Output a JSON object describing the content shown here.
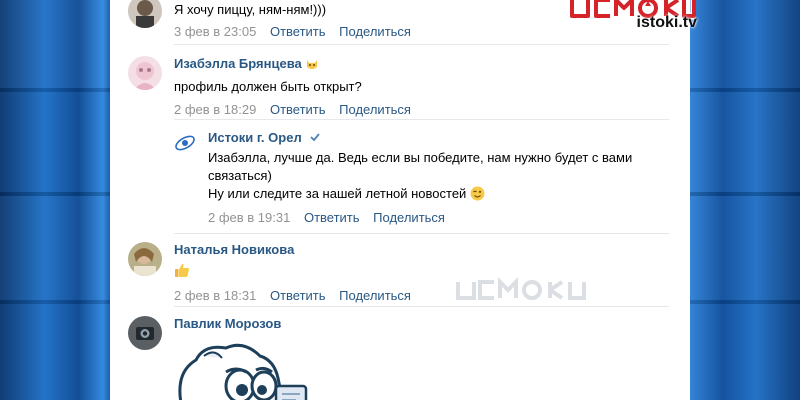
{
  "comments": [
    {
      "author": "",
      "text": "Я хочу пиццу, ням-ням!)))",
      "date": "3 фев в 23:05",
      "reply": "Ответить",
      "share": "Поделиться"
    },
    {
      "author": "Изабэлла Брянцева",
      "text": "профиль должен быть открыт?",
      "date": "2 фев в 18:29",
      "reply": "Ответить",
      "share": "Поделиться"
    },
    {
      "author": "Истоки г. Орел",
      "text_line1": "Изабэлла, лучше да. Ведь если вы победите, нам нужно будет с вами",
      "text_line2": "связаться)",
      "text_line3": "Ну или следите за нашей летной новостей",
      "date": "2 фев в 19:31",
      "reply": "Ответить",
      "share": "Поделиться"
    },
    {
      "author": "Наталья Новикова",
      "date": "2 фев в 18:31",
      "reply": "Ответить",
      "share": "Поделиться"
    },
    {
      "author": "Павлик Морозов"
    }
  ],
  "logo": {
    "site": "istoki.tv"
  },
  "colors": {
    "link": "#2a5885",
    "meta": "#939393",
    "brand_red": "#d6232a"
  },
  "icons": [
    "verified-icon",
    "cat-emoji-icon",
    "wink-emoji-icon",
    "thumbs-up-emoji-icon",
    "cat-sticker-icon"
  ]
}
